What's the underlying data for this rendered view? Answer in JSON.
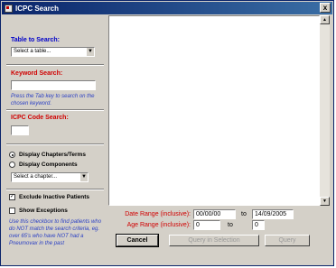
{
  "window": {
    "title": "ICPC Search",
    "close_glyph": "x"
  },
  "table_search": {
    "label": "Table to Search:",
    "selected": "Select a table..."
  },
  "keyword_search": {
    "label": "Keyword Search:",
    "value": "",
    "hint": "Press the Tab key to search on the chosen keyword."
  },
  "icpc_code_search": {
    "label": "ICPC Code Search:",
    "value": ""
  },
  "display": {
    "options": [
      {
        "label": "Display Chapters/Terms",
        "selected": true
      },
      {
        "label": "Display Components",
        "selected": false
      }
    ],
    "chapter_select": "Select a chapter..."
  },
  "filters": {
    "exclude_inactive": {
      "label": "Exclude Inactive Patients",
      "checked": true
    },
    "show_exceptions": {
      "label": "Show Exceptions",
      "checked": false
    },
    "exceptions_hint": "Use this checkbox to find patients who do NOT match the search criteria, eg. over 65's who have NOT had a Pneumovax in the past"
  },
  "date_range": {
    "label": "Date Range (inclusive):",
    "from": "00/00/00",
    "to_label": "to",
    "to": "14/09/2005"
  },
  "age_range": {
    "label": "Age Range (inclusive):",
    "from": "0",
    "to_label": "to",
    "to": "0"
  },
  "buttons": {
    "cancel": "Cancel",
    "query_selection": "Query in Selection",
    "query": "Query"
  },
  "icons": {
    "app": "icpc-app-icon",
    "scroll_up": "▲",
    "scroll_down": "▼",
    "dropdown": "▼"
  }
}
